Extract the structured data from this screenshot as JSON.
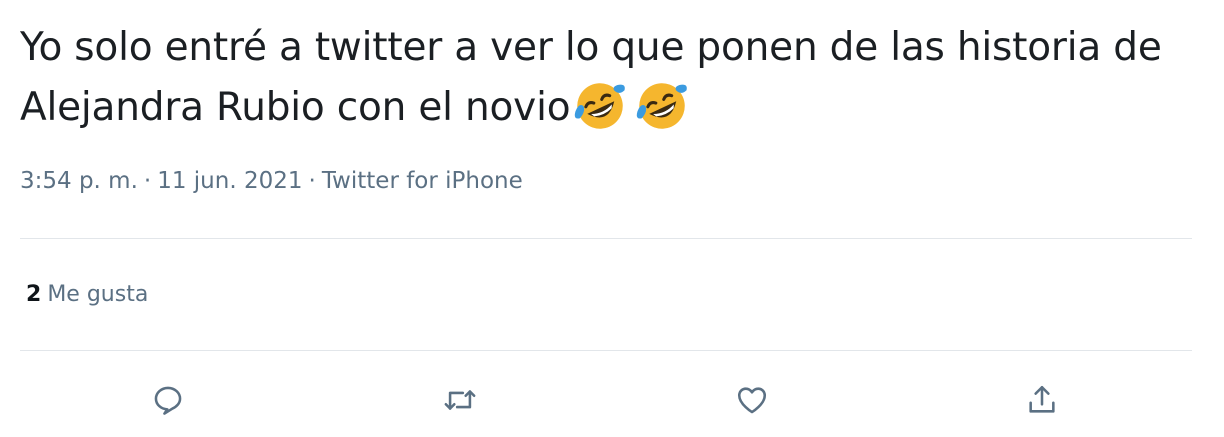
{
  "tweet": {
    "text": "Yo solo entré a twitter a ver lo que ponen de las historia de Alejandra Rubio con el novio",
    "emojis": [
      "rolling-on-floor-laughing-emoji",
      "rolling-on-floor-laughing-emoji"
    ],
    "time": "3:54 p. m.",
    "separator": "·",
    "date": "11 jun. 2021",
    "source": "Twitter for iPhone"
  },
  "stats": {
    "likes_count": "2",
    "likes_label": "Me gusta"
  },
  "actions": [
    {
      "name": "reply",
      "icon": "reply-icon"
    },
    {
      "name": "retweet",
      "icon": "retweet-icon"
    },
    {
      "name": "like",
      "icon": "heart-icon"
    },
    {
      "name": "share",
      "icon": "share-icon"
    }
  ],
  "colors": {
    "text": "#1b1f23",
    "secondary": "#5b7083",
    "divider": "#e2e6ea",
    "emoji_face": "#f5b62e",
    "emoji_tears": "#3b9be0"
  }
}
